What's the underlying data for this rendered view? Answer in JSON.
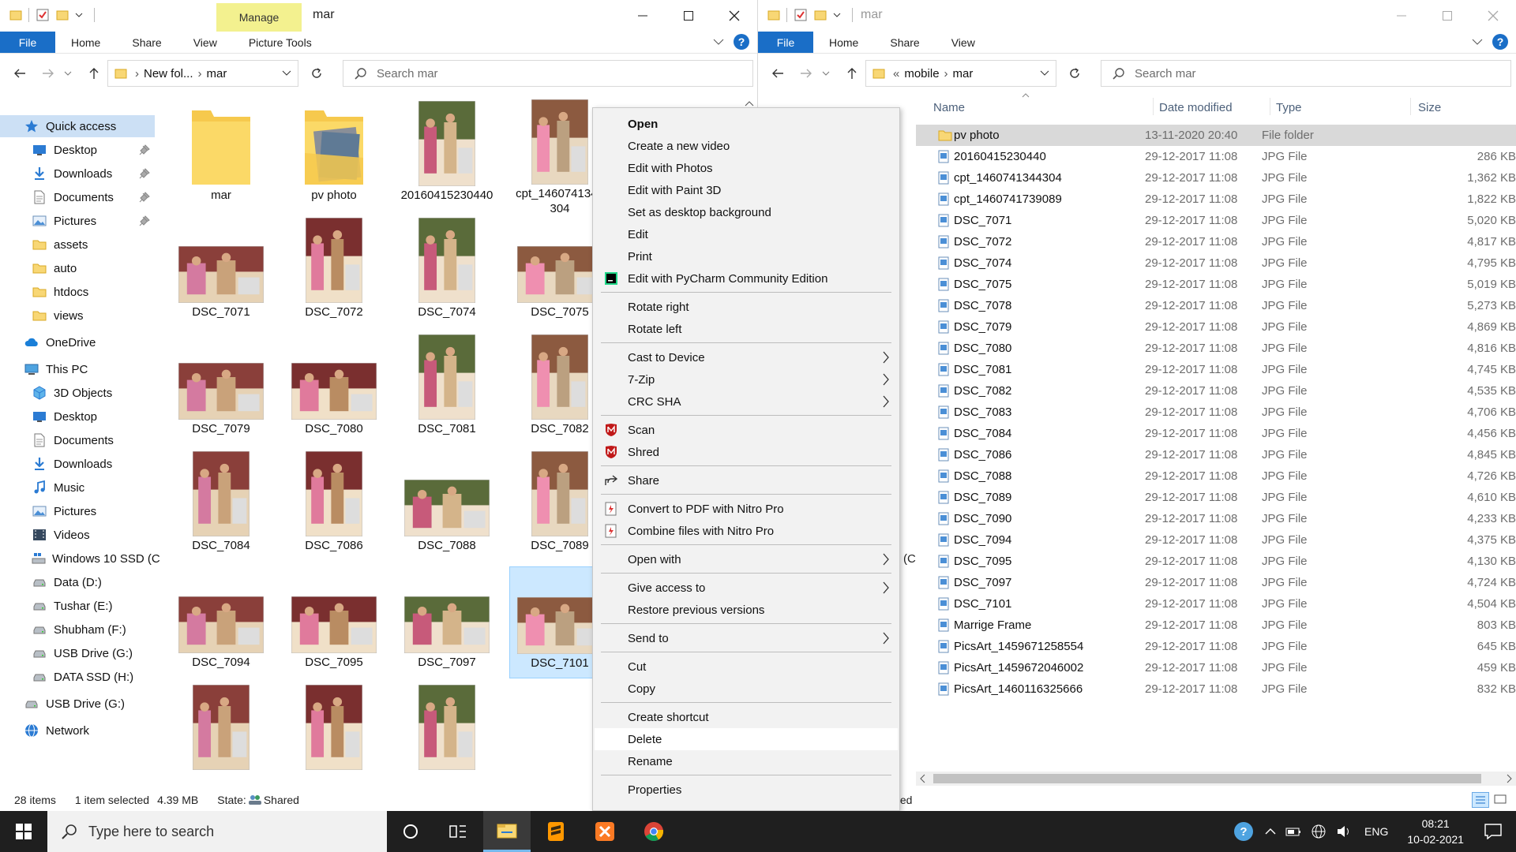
{
  "left_window": {
    "title": "mar",
    "context_tab": "Manage",
    "ribbon_tabs": [
      "File",
      "Home",
      "Share",
      "View",
      "Picture Tools"
    ],
    "address": [
      "New fol...",
      "mar"
    ],
    "search_placeholder": "Search mar",
    "nav": [
      {
        "label": "Quick access",
        "icon": "star-icon",
        "indent": 0,
        "selected": true,
        "pin": false
      },
      {
        "label": "Desktop",
        "icon": "desktop-icon",
        "indent": 1,
        "pin": true
      },
      {
        "label": "Downloads",
        "icon": "download-icon",
        "indent": 1,
        "pin": true
      },
      {
        "label": "Documents",
        "icon": "documents-icon",
        "indent": 1,
        "pin": true
      },
      {
        "label": "Pictures",
        "icon": "pictures-icon",
        "indent": 1,
        "pin": true
      },
      {
        "label": "assets",
        "icon": "folder-icon",
        "indent": 1
      },
      {
        "label": "auto",
        "icon": "folder-icon",
        "indent": 1
      },
      {
        "label": "htdocs",
        "icon": "folder-icon",
        "indent": 1
      },
      {
        "label": "views",
        "icon": "folder-icon",
        "indent": 1
      },
      {
        "label": "OneDrive",
        "icon": "cloud-icon",
        "indent": 0,
        "gap": true
      },
      {
        "label": "This PC",
        "icon": "pc-icon",
        "indent": 0,
        "gap": true
      },
      {
        "label": "3D Objects",
        "icon": "cube-icon",
        "indent": 1
      },
      {
        "label": "Desktop",
        "icon": "desktop-icon",
        "indent": 1
      },
      {
        "label": "Documents",
        "icon": "documents-icon",
        "indent": 1
      },
      {
        "label": "Downloads",
        "icon": "download-icon",
        "indent": 1
      },
      {
        "label": "Music",
        "icon": "music-icon",
        "indent": 1
      },
      {
        "label": "Pictures",
        "icon": "pictures-icon",
        "indent": 1
      },
      {
        "label": "Videos",
        "icon": "video-icon",
        "indent": 1
      },
      {
        "label": "Windows 10 SSD (C",
        "icon": "windows-drive-icon",
        "indent": 1
      },
      {
        "label": "Data (D:)",
        "icon": "drive-icon",
        "indent": 1
      },
      {
        "label": "Tushar (E:)",
        "icon": "drive-icon",
        "indent": 1
      },
      {
        "label": "Shubham (F:)",
        "icon": "drive-icon",
        "indent": 1
      },
      {
        "label": "USB Drive (G:)",
        "icon": "drive-icon",
        "indent": 1
      },
      {
        "label": "DATA SSD (H:)",
        "icon": "drive-icon",
        "indent": 1
      },
      {
        "label": "USB Drive (G:)",
        "icon": "drive-icon",
        "indent": 0,
        "gap": true
      },
      {
        "label": "Network",
        "icon": "network-icon",
        "indent": 0,
        "gap": true
      }
    ],
    "tiles": [
      {
        "label": "mar",
        "kind": "folder"
      },
      {
        "label": "pv photo",
        "kind": "folder-photos"
      },
      {
        "label": "20160415230440",
        "kind": "photo-portrait"
      },
      {
        "label": "cpt_1460741344304",
        "kind": "photo-portrait"
      },
      {
        "label": "DSC_7071",
        "kind": "photo-landscape"
      },
      {
        "label": "DSC_7072",
        "kind": "photo-portrait"
      },
      {
        "label": "DSC_7074",
        "kind": "photo-portrait"
      },
      {
        "label": "DSC_7075",
        "kind": "photo-landscape"
      },
      {
        "label": "DSC_7079",
        "kind": "photo-landscape"
      },
      {
        "label": "DSC_7080",
        "kind": "photo-landscape"
      },
      {
        "label": "DSC_7081",
        "kind": "photo-portrait"
      },
      {
        "label": "DSC_7082",
        "kind": "photo-portrait"
      },
      {
        "label": "DSC_7084",
        "kind": "photo-portrait"
      },
      {
        "label": "DSC_7086",
        "kind": "photo-portrait"
      },
      {
        "label": "DSC_7088",
        "kind": "photo-landscape"
      },
      {
        "label": "DSC_7089",
        "kind": "photo-portrait"
      },
      {
        "label": "DSC_7094",
        "kind": "photo-landscape"
      },
      {
        "label": "DSC_7095",
        "kind": "photo-landscape"
      },
      {
        "label": "DSC_7097",
        "kind": "photo-landscape"
      },
      {
        "label": "DSC_7101",
        "kind": "photo-landscape",
        "selected": true
      },
      {
        "label": "",
        "kind": "photo-portrait"
      },
      {
        "label": "",
        "kind": "photo-portrait"
      },
      {
        "label": "",
        "kind": "photo-portrait"
      }
    ],
    "status": {
      "items": "28 items",
      "selected": "1 item selected",
      "size": "4.39 MB",
      "state_label": "State:",
      "state_value": "Shared"
    }
  },
  "context_menu": {
    "items": [
      {
        "label": "Open",
        "bold": true
      },
      {
        "label": "Create a new video"
      },
      {
        "label": "Edit with Photos"
      },
      {
        "label": "Edit with Paint 3D"
      },
      {
        "label": "Set as desktop background"
      },
      {
        "label": "Edit"
      },
      {
        "label": "Print"
      },
      {
        "label": "Edit with PyCharm Community Edition",
        "icon": "pycharm-icon"
      },
      {
        "sep": true
      },
      {
        "label": "Rotate right"
      },
      {
        "label": "Rotate left"
      },
      {
        "sep": true
      },
      {
        "label": "Cast to Device",
        "submenu": true
      },
      {
        "label": "7-Zip",
        "submenu": true
      },
      {
        "label": "CRC SHA",
        "submenu": true
      },
      {
        "sep": true
      },
      {
        "label": "Scan",
        "icon": "mcafee-icon"
      },
      {
        "label": "Shred",
        "icon": "mcafee-icon"
      },
      {
        "sep": true
      },
      {
        "label": "Share",
        "icon": "share-icon"
      },
      {
        "sep": true
      },
      {
        "label": "Convert to PDF with Nitro Pro",
        "icon": "nitro-icon"
      },
      {
        "label": "Combine files with Nitro Pro",
        "icon": "nitro-icon"
      },
      {
        "sep": true
      },
      {
        "label": "Open with",
        "submenu": true
      },
      {
        "sep": true
      },
      {
        "label": "Give access to",
        "submenu": true
      },
      {
        "label": "Restore previous versions"
      },
      {
        "sep": true
      },
      {
        "label": "Send to",
        "submenu": true
      },
      {
        "sep": true
      },
      {
        "label": "Cut"
      },
      {
        "label": "Copy"
      },
      {
        "sep": true
      },
      {
        "label": "Create shortcut"
      },
      {
        "label": "Delete",
        "hover": true
      },
      {
        "label": "Rename"
      },
      {
        "sep": true
      },
      {
        "label": "Properties"
      }
    ]
  },
  "right_window": {
    "title": "mar",
    "ribbon_tabs": [
      "File",
      "Home",
      "Share",
      "View"
    ],
    "address": [
      "mobile",
      "mar"
    ],
    "search_placeholder": "Search mar",
    "columns": {
      "name": "Name",
      "date": "Date modified",
      "type": "Type",
      "size": "Size"
    },
    "rows": [
      {
        "name": "pv photo",
        "date": "13-11-2020 20:40",
        "type": "File folder",
        "size": "",
        "folder": true,
        "selected": true
      },
      {
        "name": "20160415230440",
        "date": "29-12-2017 11:08",
        "type": "JPG File",
        "size": "286 KB"
      },
      {
        "name": "cpt_1460741344304",
        "date": "29-12-2017 11:08",
        "type": "JPG File",
        "size": "1,362 KB"
      },
      {
        "name": "cpt_1460741739089",
        "date": "29-12-2017 11:08",
        "type": "JPG File",
        "size": "1,822 KB"
      },
      {
        "name": "DSC_7071",
        "date": "29-12-2017 11:08",
        "type": "JPG File",
        "size": "5,020 KB"
      },
      {
        "name": "DSC_7072",
        "date": "29-12-2017 11:08",
        "type": "JPG File",
        "size": "4,817 KB"
      },
      {
        "name": "DSC_7074",
        "date": "29-12-2017 11:08",
        "type": "JPG File",
        "size": "4,795 KB"
      },
      {
        "name": "DSC_7075",
        "date": "29-12-2017 11:08",
        "type": "JPG File",
        "size": "5,019 KB"
      },
      {
        "name": "DSC_7078",
        "date": "29-12-2017 11:08",
        "type": "JPG File",
        "size": "5,273 KB"
      },
      {
        "name": "DSC_7079",
        "date": "29-12-2017 11:08",
        "type": "JPG File",
        "size": "4,869 KB"
      },
      {
        "name": "DSC_7080",
        "date": "29-12-2017 11:08",
        "type": "JPG File",
        "size": "4,816 KB"
      },
      {
        "name": "DSC_7081",
        "date": "29-12-2017 11:08",
        "type": "JPG File",
        "size": "4,745 KB"
      },
      {
        "name": "DSC_7082",
        "date": "29-12-2017 11:08",
        "type": "JPG File",
        "size": "4,535 KB"
      },
      {
        "name": "DSC_7083",
        "date": "29-12-2017 11:08",
        "type": "JPG File",
        "size": "4,706 KB"
      },
      {
        "name": "DSC_7084",
        "date": "29-12-2017 11:08",
        "type": "JPG File",
        "size": "4,456 KB"
      },
      {
        "name": "DSC_7086",
        "date": "29-12-2017 11:08",
        "type": "JPG File",
        "size": "4,845 KB"
      },
      {
        "name": "DSC_7088",
        "date": "29-12-2017 11:08",
        "type": "JPG File",
        "size": "4,726 KB"
      },
      {
        "name": "DSC_7089",
        "date": "29-12-2017 11:08",
        "type": "JPG File",
        "size": "4,610 KB"
      },
      {
        "name": "DSC_7090",
        "date": "29-12-2017 11:08",
        "type": "JPG File",
        "size": "4,233 KB"
      },
      {
        "name": "DSC_7094",
        "date": "29-12-2017 11:08",
        "type": "JPG File",
        "size": "4,375 KB"
      },
      {
        "name": "DSC_7095",
        "date": "29-12-2017 11:08",
        "type": "JPG File",
        "size": "4,130 KB"
      },
      {
        "name": "DSC_7097",
        "date": "29-12-2017 11:08",
        "type": "JPG File",
        "size": "4,724 KB"
      },
      {
        "name": "DSC_7101",
        "date": "29-12-2017 11:08",
        "type": "JPG File",
        "size": "4,504 KB"
      },
      {
        "name": "Marrige Frame",
        "date": "29-12-2017 11:08",
        "type": "JPG File",
        "size": "803 KB"
      },
      {
        "name": "PicsArt_1459671258554",
        "date": "29-12-2017 11:08",
        "type": "JPG File",
        "size": "645 KB"
      },
      {
        "name": "PicsArt_1459672046002",
        "date": "29-12-2017 11:08",
        "type": "JPG File",
        "size": "459 KB"
      },
      {
        "name": "PicsArt_1460116325666",
        "date": "29-12-2017 11:08",
        "type": "JPG File",
        "size": "832 KB"
      }
    ],
    "status_fragment": "ted",
    "partial_nav_fragment": "(C"
  },
  "taskbar": {
    "search_placeholder": "Type here to search",
    "lang": "ENG",
    "time": "08:21",
    "date": "10-02-2021"
  },
  "colors": {
    "accent": "#1a6ec7",
    "selection": "#cce8ff",
    "manage_tab": "#f3f18f",
    "folder": "#f8d775"
  }
}
